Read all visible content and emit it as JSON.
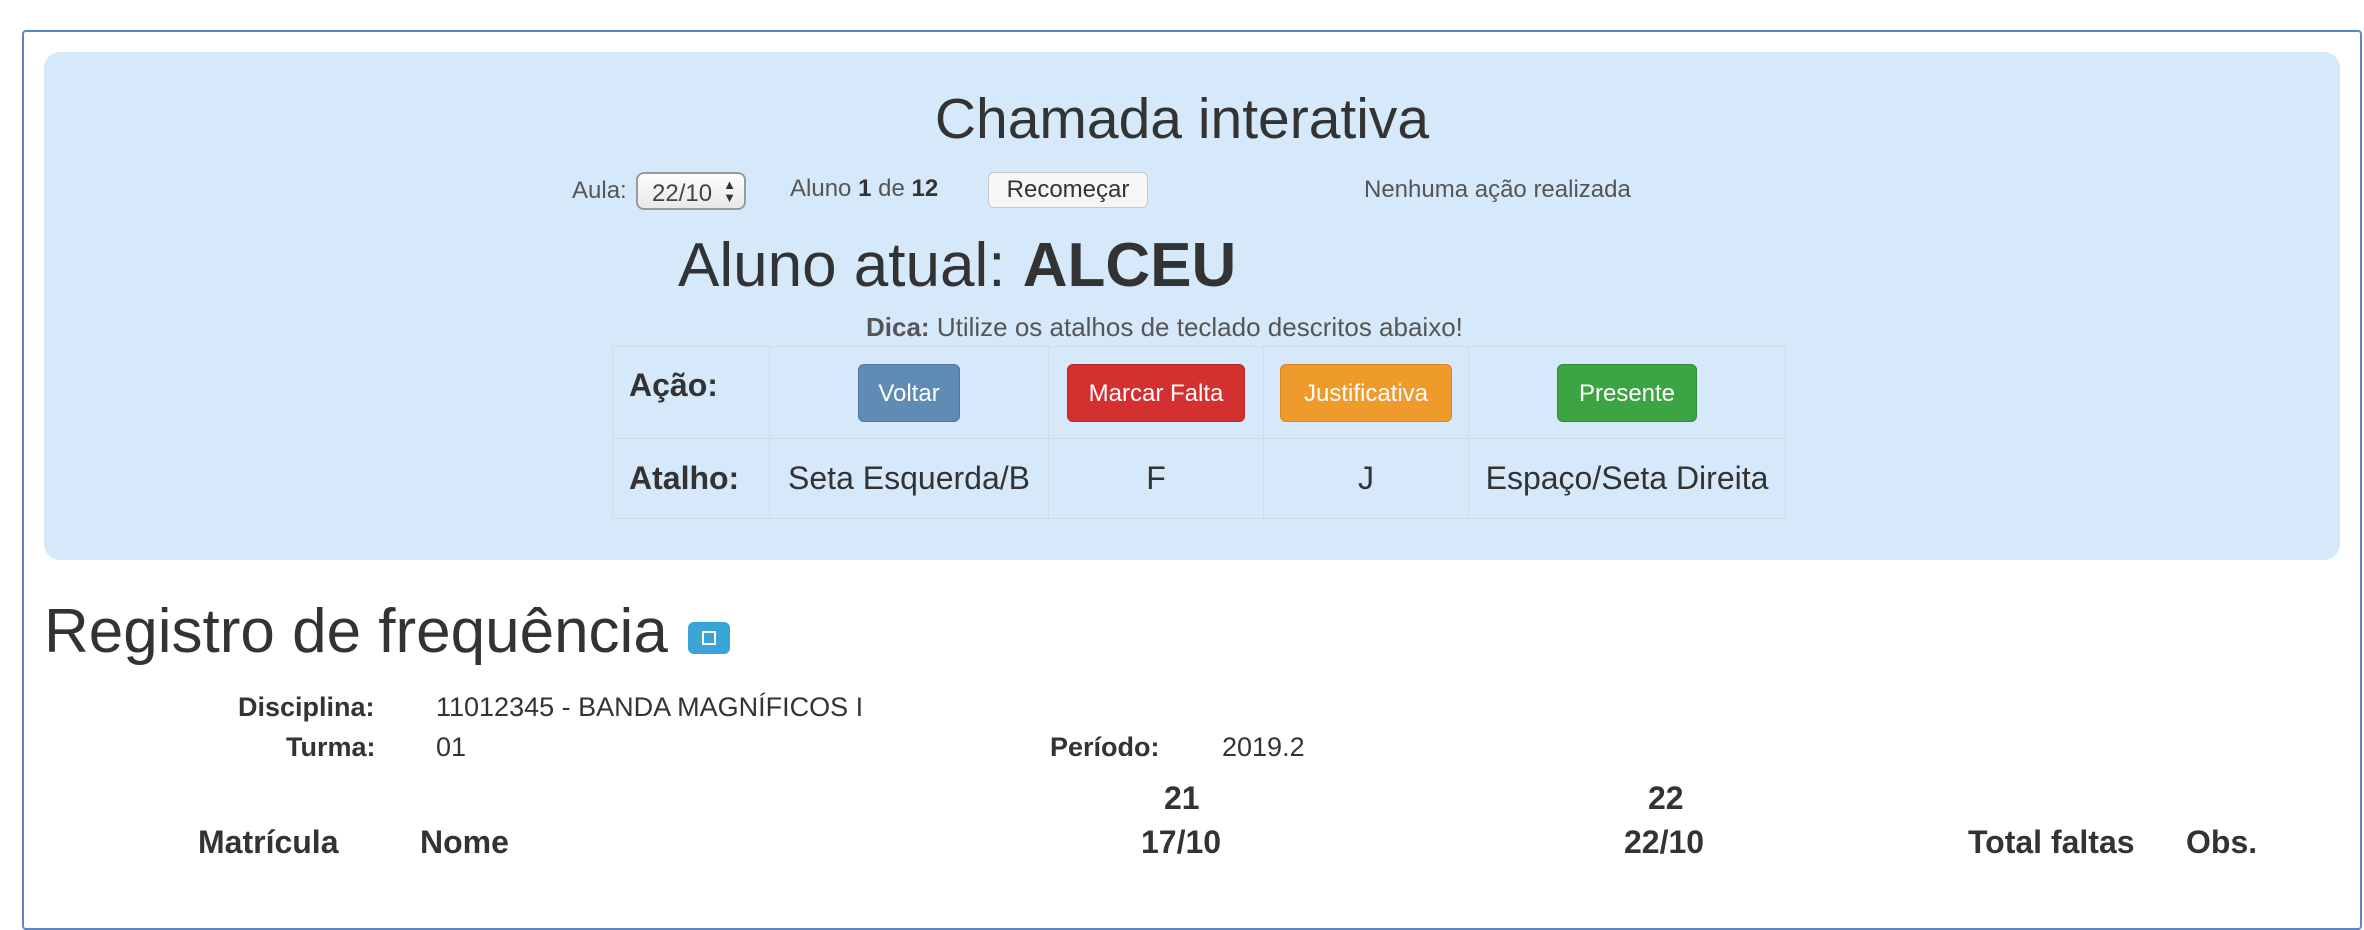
{
  "chamada": {
    "title": "Chamada interativa",
    "aula_label": "Aula:",
    "aula_value": "22/10",
    "aluno_prefix": "Aluno",
    "aluno_index": "1",
    "aluno_de": "de",
    "aluno_total": "12",
    "restart_label": "Recomeçar",
    "status": "Nenhuma ação realizada",
    "current_prefix": "Aluno atual:",
    "current_name": "ALCEU",
    "tip_bold": "Dica:",
    "tip_text": "Utilize os atalhos de teclado descritos abaixo!",
    "acao_label": "Ação:",
    "atalho_label": "Atalho:",
    "actions": [
      {
        "label": "Voltar",
        "shortcut": "Seta Esquerda/B",
        "color": "#5f8bb5"
      },
      {
        "label": "Marcar Falta",
        "shortcut": "F",
        "color": "#d3302f"
      },
      {
        "label": "Justificativa",
        "shortcut": "J",
        "color": "#ef9b2c"
      },
      {
        "label": "Presente",
        "shortcut": "Espaço/Seta Direita",
        "color": "#3da444"
      }
    ]
  },
  "registro": {
    "title": "Registro de frequência",
    "expand_icon": "expand-square-icon",
    "disciplina_label": "Disciplina:",
    "disciplina_value": "11012345 - BANDA MAGNÍFICOS I",
    "turma_label": "Turma:",
    "turma_value": "01",
    "periodo_label": "Período:",
    "periodo_value": "2019.2",
    "columns": {
      "matricula": "Matrícula",
      "nome": "Nome",
      "aula1_num": "21",
      "aula1_date": "17/10",
      "aula2_num": "22",
      "aula2_date": "22/10",
      "total": "Total faltas",
      "obs": "Obs."
    }
  }
}
